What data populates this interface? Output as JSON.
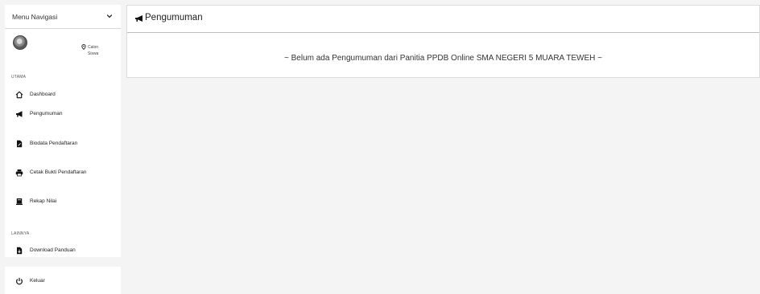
{
  "sidebar": {
    "menu_title": "Menu Navigasi",
    "user": {
      "role_line1": "Calon",
      "role_line2": "Siswa"
    },
    "sections": [
      {
        "label": "UTAMA",
        "items": [
          {
            "label": "Dashboard",
            "icon": "home-icon"
          },
          {
            "label": "Pengumuman",
            "icon": "megaphone-icon"
          },
          {
            "label": "Biodata Pendaftaran",
            "icon": "file-edit-icon"
          },
          {
            "label": "Cetak Bukti Pendaftaran",
            "icon": "print-icon"
          },
          {
            "label": "Rekap Nilai",
            "icon": "book-icon"
          }
        ]
      },
      {
        "label": "LAINNYA",
        "items": [
          {
            "label": "Download Panduan",
            "icon": "file-download-icon"
          }
        ]
      }
    ],
    "footer": {
      "logout_label": "Keluar",
      "icon": "power-icon"
    }
  },
  "main": {
    "title": "Pengumuman",
    "icon": "megaphone-icon",
    "message": "~ Belum ada Pengumuman dari Panitia PPDB Online SMA NEGERI 5 MUARA TEWEH ~"
  }
}
